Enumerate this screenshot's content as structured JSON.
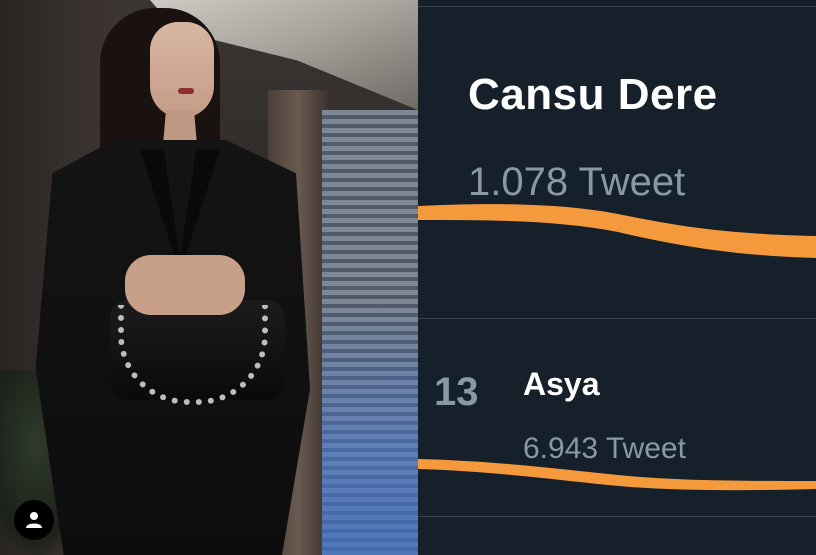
{
  "photo": {
    "profile_icon": "user-icon"
  },
  "trends": [
    {
      "rank": "",
      "name": "Cansu Dere",
      "count": "1.078 Tweet"
    },
    {
      "rank": "13",
      "name": "Asya",
      "count": "6.943 Tweet"
    }
  ],
  "colors": {
    "background": "#15202b",
    "primary_text": "#ffffff",
    "secondary_text": "#8899a6",
    "divider": "#38444d",
    "highlight_marker": "#f59a3c"
  }
}
